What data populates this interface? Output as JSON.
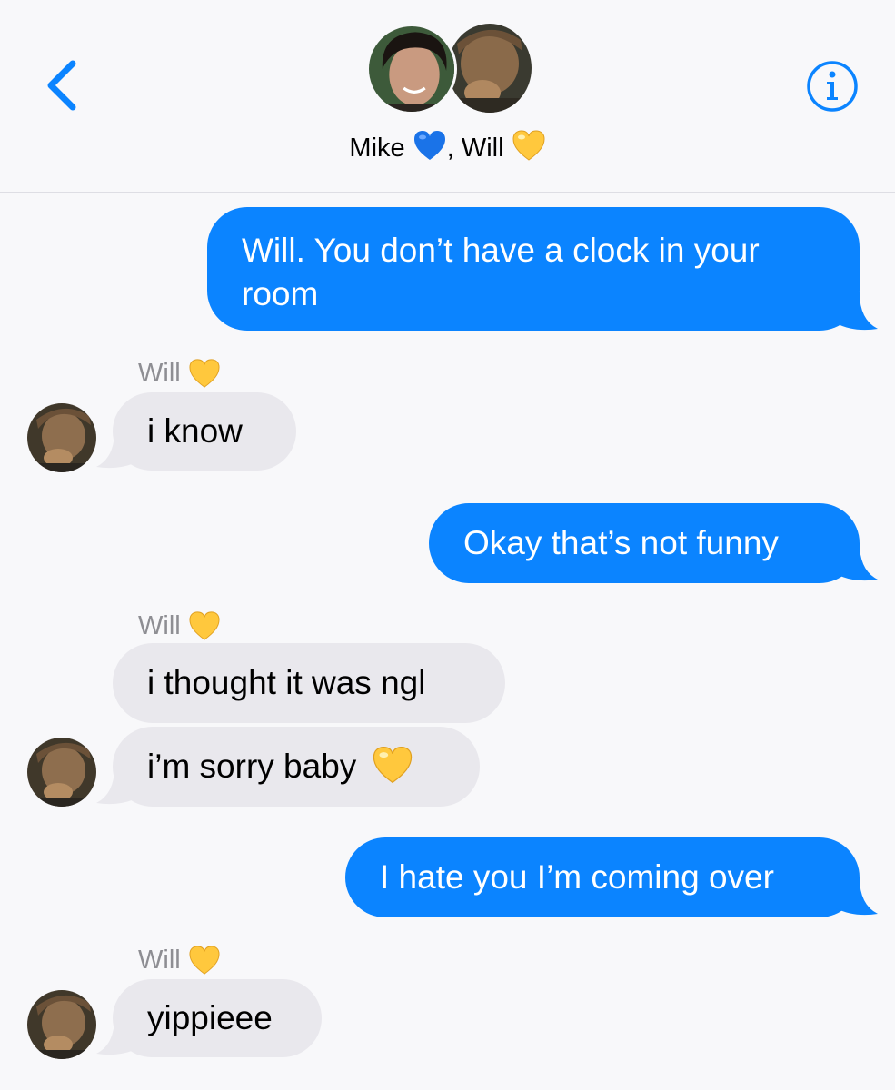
{
  "header": {
    "group_name_first": "Mike",
    "group_name_second": ", Will",
    "first_heart": "blue-heart",
    "second_heart": "yellow-heart",
    "accent_color": "#0b84ff"
  },
  "messages": [
    {
      "direction": "sent",
      "line1": "Will. You don’t have a clock in your",
      "line2": "room"
    },
    {
      "direction": "received",
      "sender": "Will",
      "text": "i know"
    },
    {
      "direction": "sent",
      "text": "Okay that’s not funny"
    },
    {
      "direction": "received",
      "sender": "Will",
      "text": "i thought it was ngl"
    },
    {
      "direction": "received",
      "text": "i’m sorry baby"
    },
    {
      "direction": "sent",
      "text": "I hate you I’m coming over"
    },
    {
      "direction": "received",
      "sender": "Will",
      "text": "yippieee"
    }
  ],
  "colors": {
    "sent_bubble": "#0b84ff",
    "received_bubble": "#e9e8ed",
    "background": "#f8f8fa",
    "sender_label": "#8e8e93",
    "yellow_heart": "#ffc83d",
    "blue_heart": "#1a73e8"
  }
}
